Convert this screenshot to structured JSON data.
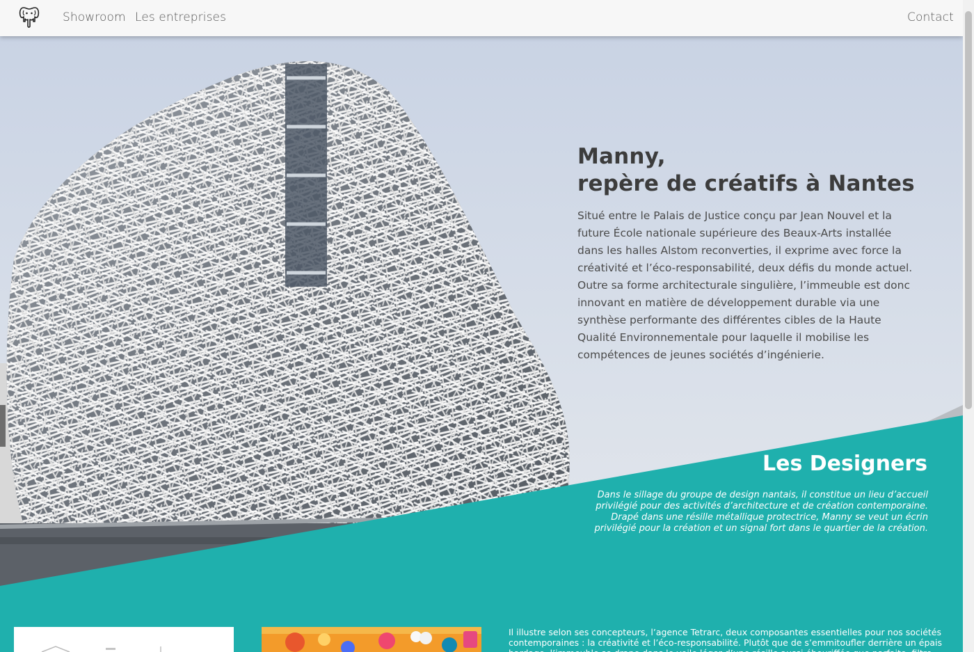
{
  "nav": {
    "logo_icon": "elephant-logo-icon",
    "links": [
      "Showroom",
      "Les entreprises"
    ],
    "contact": "Contact"
  },
  "hero": {
    "title_line1": "Manny,",
    "title_line2": "repère de créatifs à Nantes",
    "paragraph": "Situé entre le Palais de Justice conçu par Jean Nouvel et la future École nationale supérieure des Beaux-Arts installée dans les halles Alstom reconverties, il exprime avec force la créativité et l’éco-responsabilité, deux défis du monde actuel. Outre sa forme architecturale singulière, l’immeuble est donc innovant en matière de développement durable via une synthèse performante des différentes cibles de la Haute Qualité Environnementale pour laquelle il mobilise les compétences de jeunes sociétés d’ingénierie."
  },
  "designers": {
    "title": "Les Designers",
    "text": "Dans le sillage du groupe de design nantais, il constitue un lieu d’accueil privilégié pour des activités d’architecture et de création contemporaine. Drapé dans une résille métallique protectrice, Manny se veut un écrin privilégié pour la création et un signal fort dans le quartier de la création."
  },
  "bottom": {
    "text": "Il illustre selon ses concepteurs, l’agence Tetrarc, deux composantes essentielles pour nos sociétés contemporaines : la créativité et l’éco-responsabilité. Plutôt que de s’emmitoufler derrière un épais bardage, l’immeuble se drape dans le voile léger d’une résille aussi ébouriffée que parfaite, filtre solaire"
  },
  "colors": {
    "accent": "#1fb0ad",
    "navbar": "#f7f7f7",
    "title": "#3c3c3c"
  }
}
